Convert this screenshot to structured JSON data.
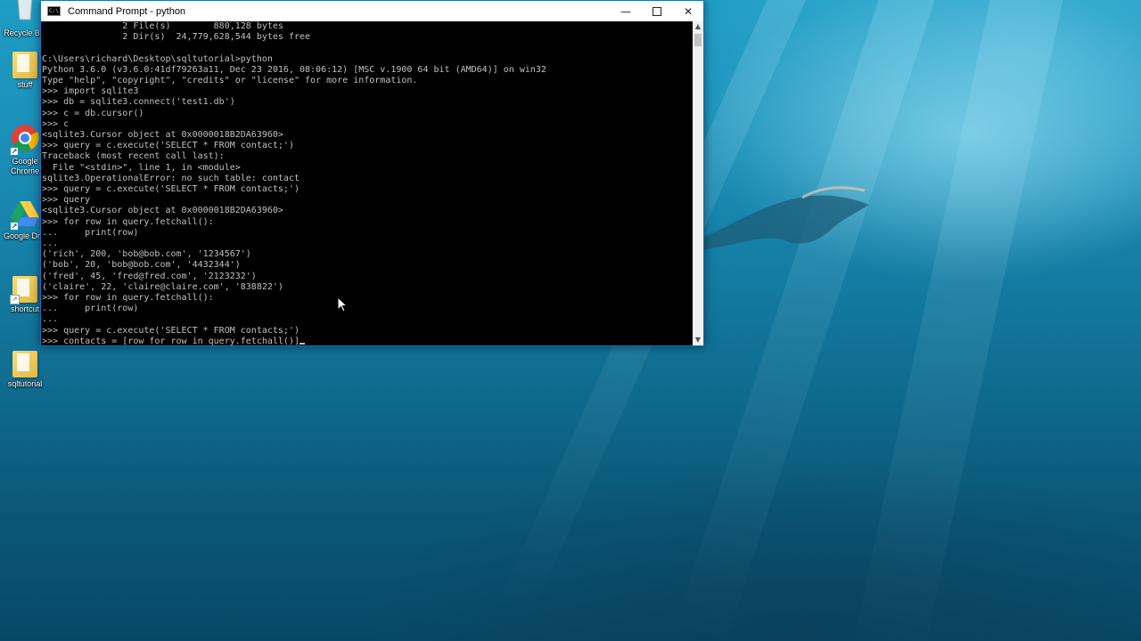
{
  "window": {
    "title": "Command Prompt - python",
    "icon_text": "C:\\",
    "minimize_glyph": "—",
    "close_glyph": "✕"
  },
  "console": {
    "lines": [
      "               2 File(s)        880,128 bytes",
      "               2 Dir(s)  24,779,628,544 bytes free",
      "",
      "C:\\Users\\richard\\Desktop\\sqltutorial>python",
      "Python 3.6.0 (v3.6.0:41df79263a11, Dec 23 2016, 08:06:12) [MSC v.1900 64 bit (AMD64)] on win32",
      "Type \"help\", \"copyright\", \"credits\" or \"license\" for more information.",
      ">>> import sqlite3",
      ">>> db = sqlite3.connect('test1.db')",
      ">>> c = db.cursor()",
      ">>> c",
      "<sqlite3.Cursor object at 0x0000018B2DA63960>",
      ">>> query = c.execute('SELECT * FROM contact;')",
      "Traceback (most recent call last):",
      "  File \"<stdin>\", line 1, in <module>",
      "sqlite3.OperationalError: no such table: contact",
      ">>> query = c.execute('SELECT * FROM contacts;')",
      ">>> query",
      "<sqlite3.Cursor object at 0x0000018B2DA63960>",
      ">>> for row in query.fetchall():",
      "...     print(row)",
      "...",
      "('rich', 200, 'bob@bob.com', '1234567')",
      "('bob', 20, 'bob@bob.com', '4432344')",
      "('fred', 45, 'fred@fred.com', '2123232')",
      "('claire', 22, 'claire@claire.com', '838822')",
      ">>> for row in query.fetchall():",
      "...     print(row)",
      "...",
      ">>> query = c.execute('SELECT * FROM contacts;')"
    ],
    "current_input": ">>> contacts = [row for row in query.fetchall()]"
  },
  "desktop": {
    "icons": [
      {
        "label": "Recycle Bin",
        "icon": "recycle-bin-icon"
      },
      {
        "label": "stuff",
        "icon": "folder-icon"
      },
      {
        "label": "Google Chrome",
        "icon": "chrome-icon"
      },
      {
        "label": "Google Drive",
        "icon": "google-drive-icon"
      },
      {
        "label": "shortcut",
        "icon": "folder-shortcut-icon"
      },
      {
        "label": "sqltutorial",
        "icon": "folder-icon"
      }
    ]
  },
  "colors": {
    "console_bg": "#000000",
    "console_fg": "#c0c0c0",
    "desktop_water": "#137aa0",
    "window_border": "#1a6ec2"
  }
}
